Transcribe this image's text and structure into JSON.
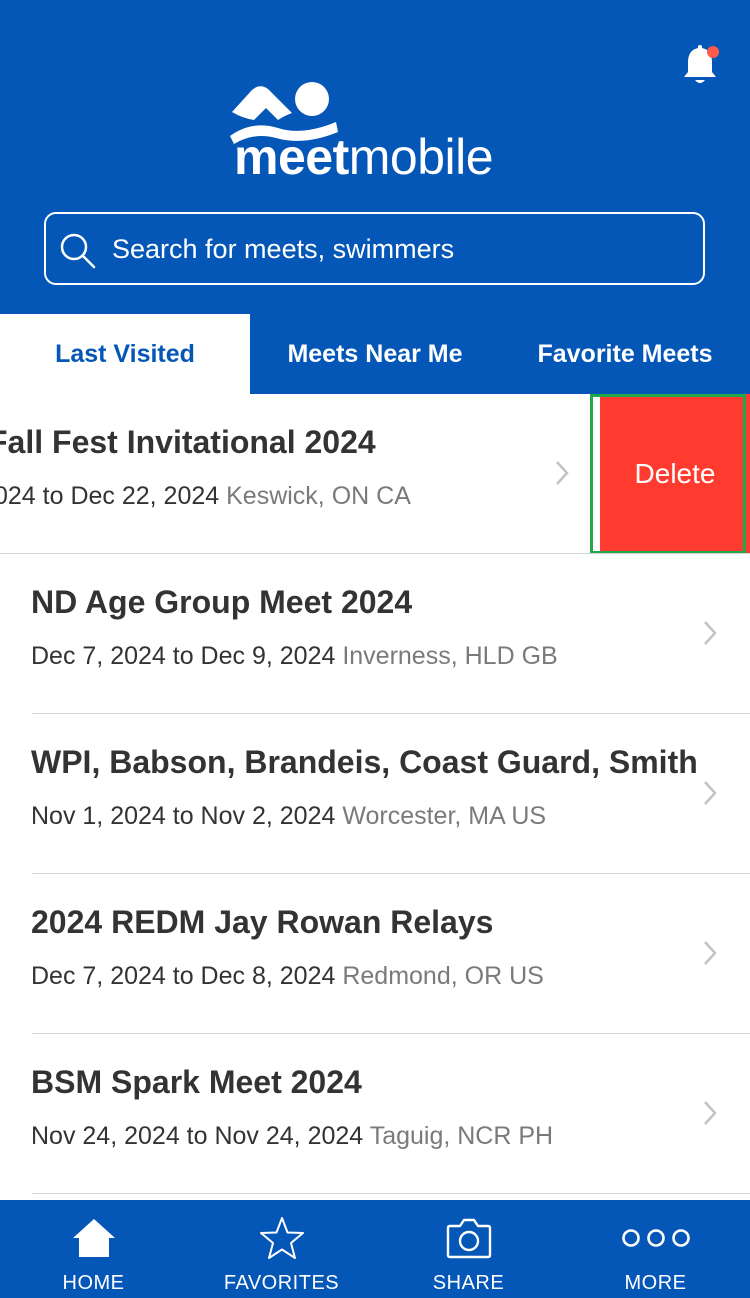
{
  "header": {
    "logo_bold": "meet",
    "logo_light": "mobile",
    "search_placeholder": "Search for meets, swimmers"
  },
  "tabs": [
    {
      "label": "Last Visited",
      "active": true
    },
    {
      "label": "Meets Near Me",
      "active": false
    },
    {
      "label": "Favorite Meets",
      "active": false
    }
  ],
  "meets": [
    {
      "title": "Fall Fest Invitational 2024",
      "dates": "024 to Dec 22, 2024",
      "location": "Keswick, ON CA"
    },
    {
      "title": "ND Age Group Meet 2024",
      "dates": "Dec 7, 2024 to Dec 9, 2024",
      "location": "Inverness, HLD GB"
    },
    {
      "title": "WPI, Babson, Brandeis, Coast Guard, Smith",
      "dates": "Nov 1, 2024 to Nov 2, 2024",
      "location": "Worcester, MA US"
    },
    {
      "title": "2024 REDM Jay Rowan Relays",
      "dates": "Dec 7, 2024 to Dec 8, 2024",
      "location": "Redmond, OR US"
    },
    {
      "title": "BSM Spark Meet 2024",
      "dates": "Nov 24, 2024 to Nov 24, 2024",
      "location": "Taguig, NCR PH"
    }
  ],
  "delete_label": "Delete",
  "bottom_nav": [
    {
      "label": "HOME",
      "icon": "home-icon"
    },
    {
      "label": "FAVORITES",
      "icon": "star-icon"
    },
    {
      "label": "SHARE",
      "icon": "camera-icon"
    },
    {
      "label": "MORE",
      "icon": "more-icon"
    }
  ],
  "colors": {
    "brand_blue": "#0557b7",
    "delete_red": "#ff3b30",
    "notification_dot": "#ff5a4a",
    "highlight_green": "#22a84a"
  }
}
